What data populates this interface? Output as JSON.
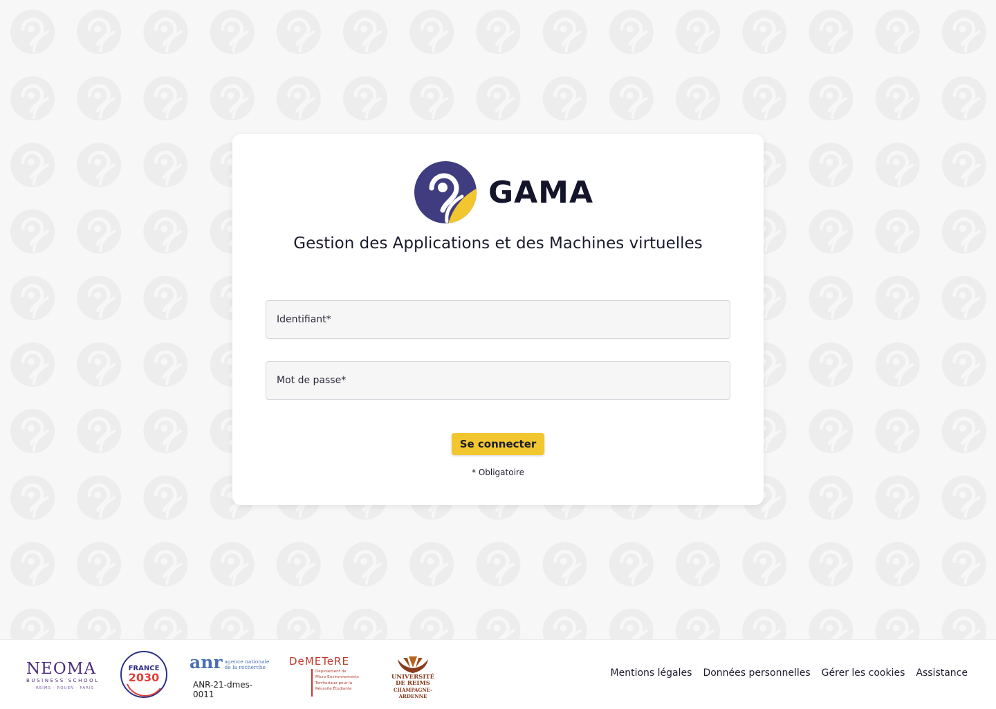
{
  "colors": {
    "page_background": "#f7f7f8",
    "card_background": "#ffffff",
    "brand_purple": "#3f3d7f",
    "brand_yellow": "#f2c62f",
    "button_background": "#f2c62f"
  },
  "brand": {
    "logo_icon": "gama-logo-icon",
    "name": "GAMA",
    "subtitle": "Gestion des Applications et des Machines virtuelles"
  },
  "form": {
    "username": {
      "placeholder": "Identifiant*",
      "value": ""
    },
    "password": {
      "placeholder": "Mot de passe*",
      "value": ""
    },
    "submit_label": "Se connecter",
    "required_note": "* Obligatoire"
  },
  "footer": {
    "partners": {
      "neoma": {
        "name": "NEOMA",
        "tagline": "BUSINESS SCHOOL",
        "cities": "REIMS · ROUEN · PARIS"
      },
      "france2030": {
        "line1": "FRANCE",
        "line2": "2030"
      },
      "anr": {
        "name": "anr",
        "description_line1": "agence nationale",
        "description_line2": "de la recherche",
        "grant_code": "ANR-21-dmes-0011"
      },
      "demetere": {
        "name": "DeMETeRE",
        "description_lines": [
          "Déploiement de",
          "Micro-Environnements",
          "Territoriaux pour la",
          "Réussite Étudiante"
        ]
      },
      "urca": {
        "line1": "UNIVERSITÉ",
        "line2": "DE REIMS",
        "line3": "CHAMPAGNE-ARDENNE"
      }
    },
    "links": [
      {
        "label": "Mentions légales"
      },
      {
        "label": "Données personnelles"
      },
      {
        "label": "Gérer les cookies"
      },
      {
        "label": "Assistance"
      }
    ]
  }
}
